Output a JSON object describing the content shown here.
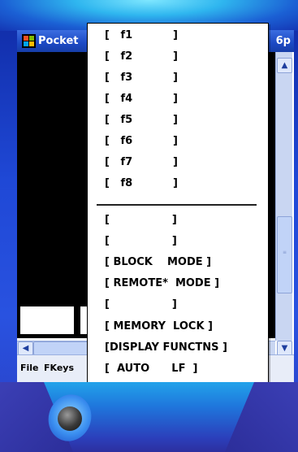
{
  "window": {
    "title": "Pocket",
    "title_tail": "6p"
  },
  "menubar": {
    "file_label": "File",
    "fkeys_label": "FKeys"
  },
  "popup_menu": {
    "items_top": [
      "[   f1           ]",
      "[   f2           ]",
      "[   f3           ]",
      "[   f4           ]",
      "[   f5           ]",
      "[   f6           ]",
      "[   f7           ]",
      "[   f8           ]"
    ],
    "items_bottom": [
      "[                 ]",
      "[                 ]",
      "[ BLOCK    MODE ]",
      "[ REMOTE*  MODE ]",
      "[                 ]",
      "[ MEMORY  LOCK ]",
      "[DISPLAY FUNCTNS ]",
      "[  AUTO      LF  ]"
    ]
  },
  "scroll": {
    "up_icon": "▲",
    "down_icon": "▼",
    "left_icon": "◀"
  },
  "colors": {
    "titlebar": "#1c49c4",
    "terminal_bg": "#000000",
    "scrollbar": "#c9d6f2"
  }
}
